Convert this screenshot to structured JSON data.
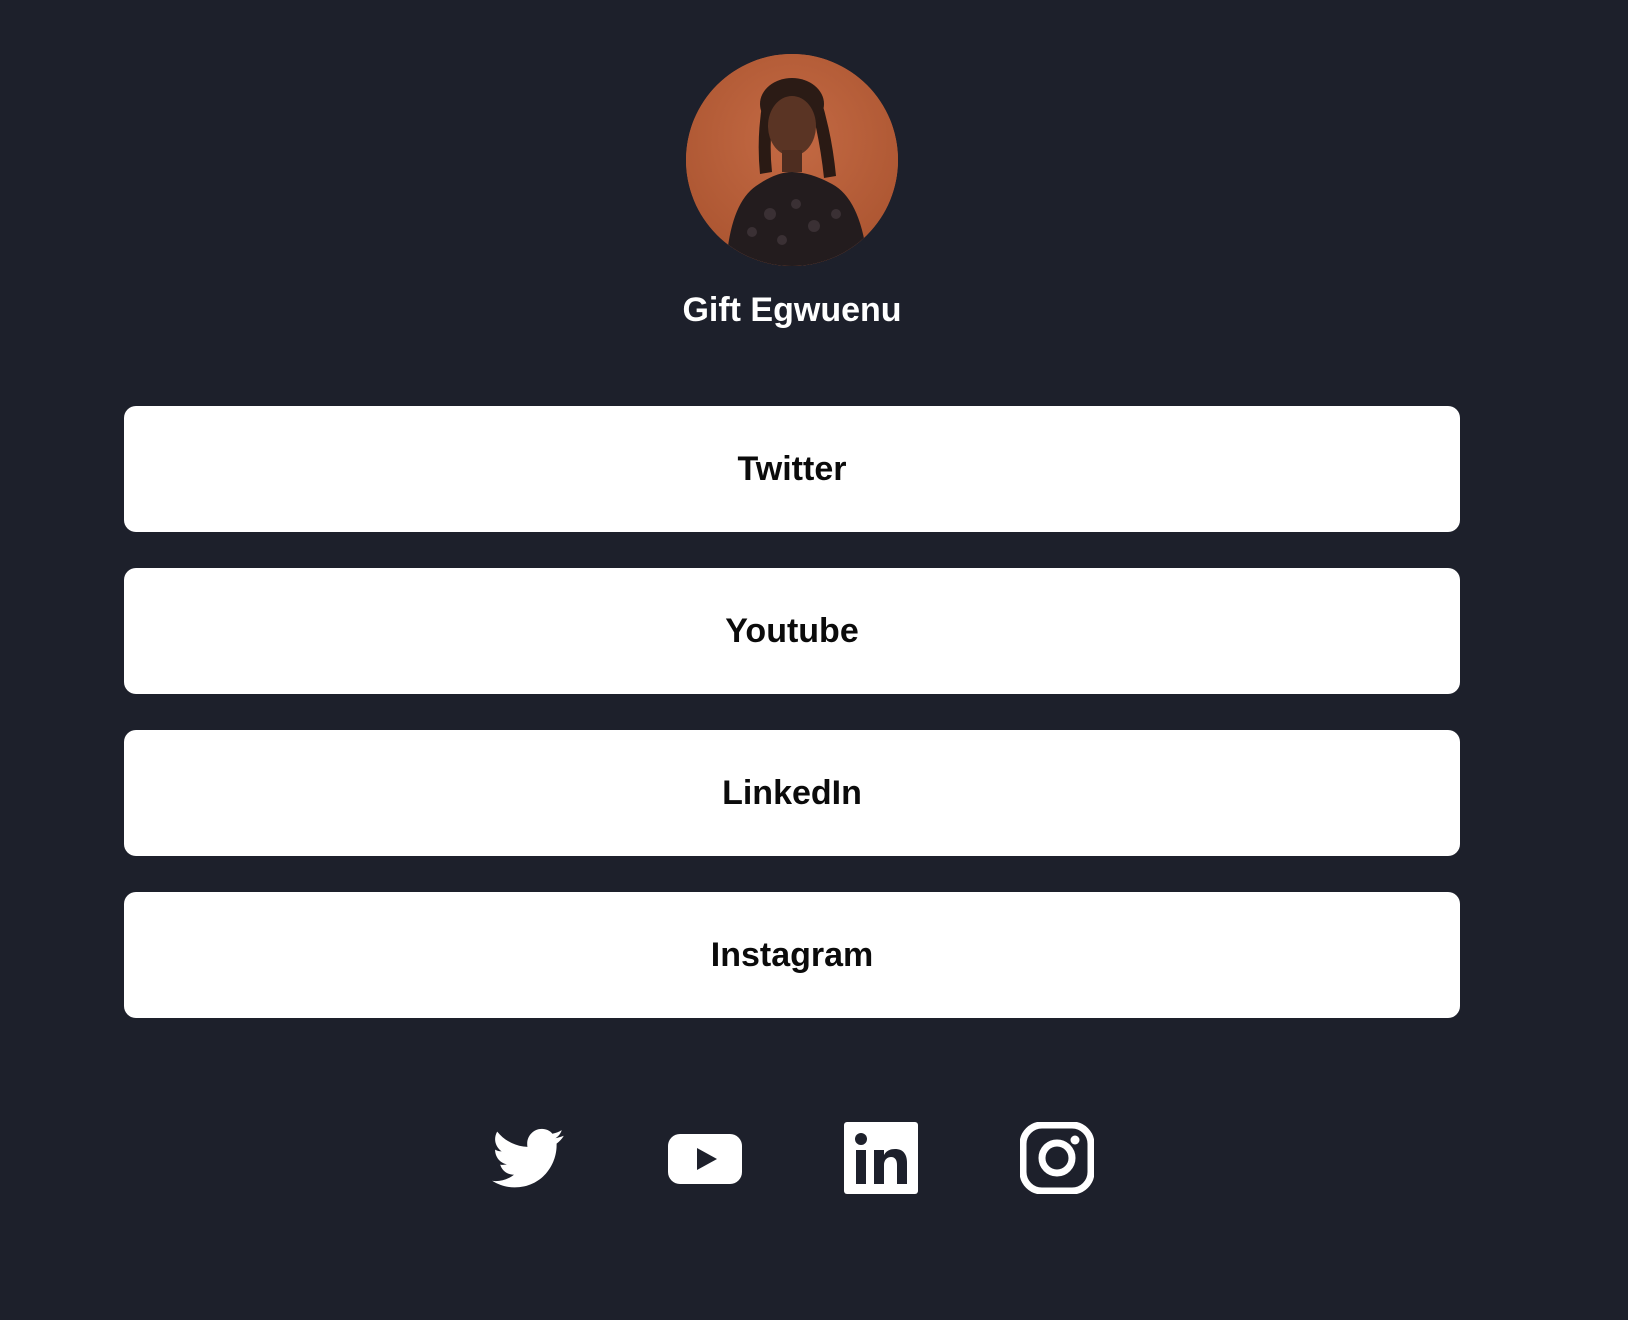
{
  "profile": {
    "name": "Gift Egwuenu",
    "avatar_icon": "profile-photo"
  },
  "links": [
    {
      "label": "Twitter"
    },
    {
      "label": "Youtube"
    },
    {
      "label": "LinkedIn"
    },
    {
      "label": "Instagram"
    }
  ],
  "social_icons": [
    "twitter-icon",
    "youtube-icon",
    "linkedin-icon",
    "instagram-icon"
  ],
  "colors": {
    "background": "#1d202b",
    "button": "#ffffff",
    "button_text": "#0b0b0b",
    "name_text": "#ffffff",
    "icon": "#ffffff"
  }
}
